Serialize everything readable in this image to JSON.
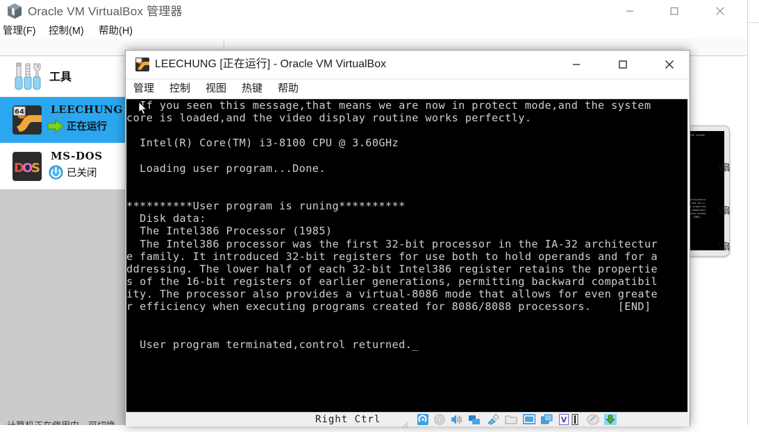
{
  "manager_window": {
    "title": "Oracle VM VirtualBox 管理器",
    "logo_icon": "virtualbox-logo-icon",
    "menus": [
      {
        "label": "管理(F)",
        "name": "menu-file"
      },
      {
        "label": "控制(M)",
        "name": "menu-machine"
      },
      {
        "label": "帮助(H)",
        "name": "menu-help"
      }
    ],
    "window_controls": [
      {
        "name": "minimize-button",
        "glyph": "minimize-icon"
      },
      {
        "name": "maximize-button",
        "glyph": "maximize-icon"
      },
      {
        "name": "close-button",
        "glyph": "close-icon"
      }
    ],
    "sidebar": {
      "tools_label": "工具",
      "tools_icon": "tools-icon",
      "items": [
        {
          "name": "LEECHUNG",
          "state": "正在运行",
          "state_icon": "green-arrow-running-icon",
          "os_icon": "windows-64-icon",
          "badge": "64",
          "selected": true
        },
        {
          "name": "MS-DOS",
          "state": "已关闭",
          "state_icon": "power-off-icon",
          "os_icon": "dos-icon",
          "badge": "",
          "selected": false
        }
      ]
    },
    "detail_panel": {
      "preview_label": "vm-preview-thumbnail",
      "preview_lines": [
        "l the system",
        "",
        "",
        "",
        "",
        "",
        "",
        "",
        "",
        "",
        "",
        "",
        "",
        "",
        "",
        "",
        "",
        "",
        "",
        "2 architectur",
        "ds and for a",
        "the propertie",
        "rd compatibil",
        "r even greate",
        "rs.    [END]"
      ],
      "clipped_rows": [
        "\\扇",
        "\\扇",
        "\\扇"
      ]
    },
    "status_strip_text": "计算机正在使用中，可切换"
  },
  "vm_window": {
    "title": "LEECHUNG [正在运行] - Oracle VM VirtualBox",
    "icon": "vm-machine-icon",
    "menus": [
      {
        "label": "管理",
        "name": "vm-menu-file"
      },
      {
        "label": "控制",
        "name": "vm-menu-machine"
      },
      {
        "label": "视图",
        "name": "vm-menu-view"
      },
      {
        "label": "热键",
        "name": "vm-menu-input"
      },
      {
        "label": "帮助",
        "name": "vm-menu-help"
      }
    ],
    "window_controls": [
      {
        "name": "vm-minimize-button",
        "glyph": "minimize-icon"
      },
      {
        "name": "vm-maximize-button",
        "glyph": "maximize-icon"
      },
      {
        "name": "vm-close-button",
        "glyph": "close-icon"
      }
    ],
    "console": {
      "cursor_icon": "mouse-pointer-icon",
      "lines": [
        "  If you seen this message,that means we are now in protect mode,and the system",
        "core is loaded,and the video display routine works perfectly.",
        "",
        "  Intel(R) Core(TM) i3-8100 CPU @ 3.60GHz",
        "",
        "  Loading user program...Done.",
        "",
        "",
        "**********User program is runing**********",
        "  Disk data:",
        "  The Intel386 Processor (1985)",
        "  The Intel386 processor was the first 32-bit processor in the IA-32 architectur",
        "e family. It introduced 32-bit registers for use both to hold operands and for a",
        "ddressing. The lower half of each 32-bit Intel386 register retains the propertie",
        "s of the 16-bit registers of earlier generations, permitting backward compatibil",
        "ity. The processor also provides a virtual-8086 mode that allows for even greate",
        "r efficiency when executing programs created for 8086/8088 processors.    [END]",
        "",
        "",
        "  User program terminated,control returned._"
      ]
    },
    "status_bar": {
      "host_key_label": "Right Ctrl",
      "icons": [
        {
          "name": "hard-disk-icon"
        },
        {
          "name": "optical-disk-icon"
        },
        {
          "name": "audio-icon"
        },
        {
          "name": "network-icon"
        },
        {
          "name": "usb-icon"
        },
        {
          "name": "shared-folder-icon"
        },
        {
          "name": "display-icon"
        },
        {
          "name": "video-capture-icon"
        },
        {
          "name": "remote-desktop-icon"
        },
        {
          "name": "keyboard-indicator-icon"
        },
        {
          "name": "mouse-integration-icon"
        },
        {
          "name": "host-key-icon"
        }
      ],
      "resize-grip": "resize-grip-icon"
    }
  },
  "colors": {
    "selection_blue": "#2aa7ef",
    "console_bg": "#000000",
    "console_fg": "#d0d0d0",
    "window_bg": "#ffffff",
    "panel_grey": "#cbcbcb",
    "status_bg": "#efefef"
  }
}
